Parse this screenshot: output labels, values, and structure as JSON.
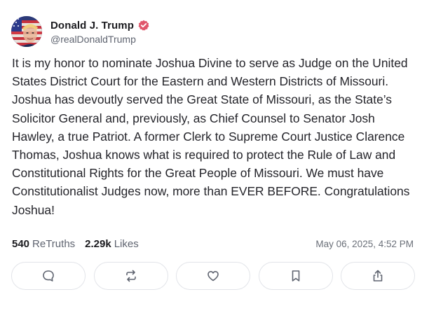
{
  "author": {
    "display_name": "Donald J. Trump",
    "handle": "@realDonaldTrump",
    "verified": true,
    "verified_color": "#e0566b",
    "avatar_icon": "avatar-flag-portrait"
  },
  "post": {
    "text": "It is my honor to nominate Joshua Divine to serve as Judge on the United States District Court for the Eastern and Western Districts of Missouri. Joshua has devoutly served the Great State of Missouri, as the State’s Solicitor General and, previously, as Chief Counsel to Senator Josh Hawley, a true Patriot. A former Clerk to Supreme Court Justice Clarence Thomas, Joshua knows what is required to protect the Rule of Law and Constitutional Rights for the Great People of Missouri. We must have Constitutionalist Judges now, more than EVER BEFORE. Congratulations Joshua!",
    "timestamp": "May 06, 2025, 4:52 PM"
  },
  "stats": {
    "retruths_count": "540",
    "retruths_label": "ReTruths",
    "likes_count": "2.29k",
    "likes_label": "Likes"
  },
  "actions": [
    {
      "name": "reply",
      "icon": "comment-icon"
    },
    {
      "name": "retruth",
      "icon": "repost-icon"
    },
    {
      "name": "like",
      "icon": "heart-icon"
    },
    {
      "name": "bookmark",
      "icon": "bookmark-icon"
    },
    {
      "name": "share",
      "icon": "share-icon"
    }
  ],
  "colors": {
    "text": "#24242a",
    "muted": "#5f6470",
    "border": "#e2e4e9",
    "icon": "#5f6470"
  }
}
